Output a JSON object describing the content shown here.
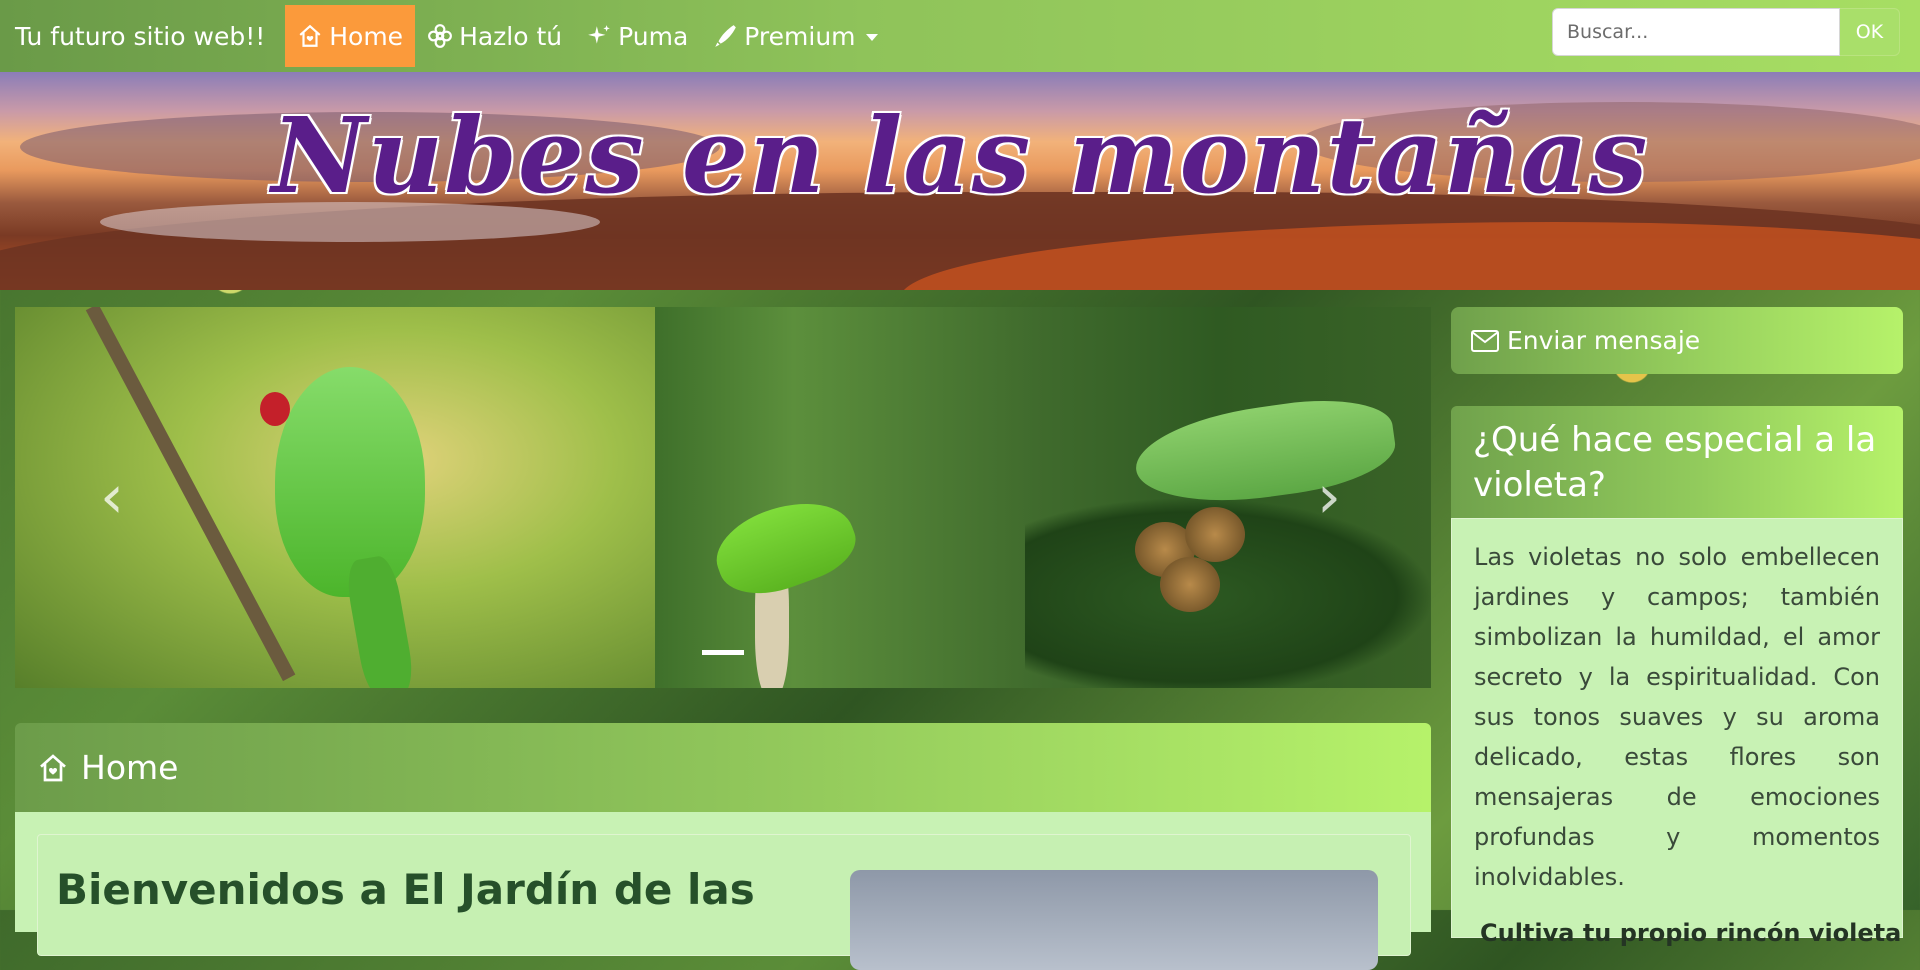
{
  "navbar": {
    "brand": "Tu futuro sitio web!!",
    "items": [
      {
        "label": "Home",
        "icon": "house-icon",
        "active": true
      },
      {
        "label": "Hazlo tú",
        "icon": "flower-icon",
        "active": false
      },
      {
        "label": "Puma",
        "icon": "sparkles-icon",
        "active": false
      },
      {
        "label": "Premium",
        "icon": "pen-icon",
        "active": false,
        "dropdown": true
      }
    ],
    "search": {
      "placeholder": "Buscar...",
      "button": "OK"
    }
  },
  "banner": {
    "title": "Nubes en las montañas"
  },
  "carousel": {
    "prev": "‹",
    "next": "›",
    "slides": 1,
    "active_slide": 1
  },
  "home": {
    "header": "Home",
    "title": "Bienvenidos a El Jardín de las"
  },
  "sidebar": {
    "message_button": "Enviar mensaje",
    "card": {
      "title": "¿Qué hace especial a la violeta?",
      "text": "Las violetas no solo embellecen jardines y campos; también simbolizan la humildad, el amor secreto y la espiritualidad. Con sus tonos suaves y su aroma delicado, estas flores son mensajeras de emociones profundas y momentos inolvidables.",
      "subheading": "Cultiva tu propio rincón violeta"
    }
  },
  "colors": {
    "nav_active": "#fb9a3b",
    "nav_gradient_start": "#6a9a48",
    "nav_gradient_end": "#a7de63",
    "banner_title": "#5a1e8a",
    "card_body": "#c8f2b4"
  }
}
